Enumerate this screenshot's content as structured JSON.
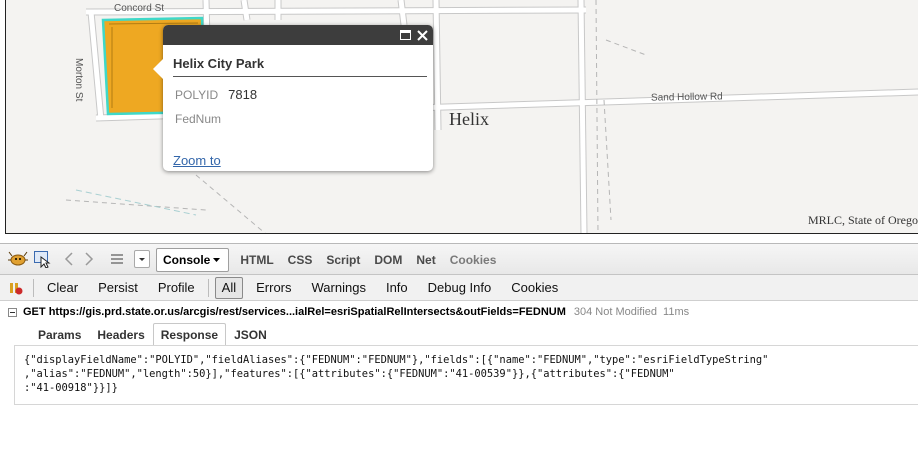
{
  "map": {
    "streets": {
      "concord": "Concord St",
      "morton": "Morton St",
      "sand_hollow": "Sand Hollow Rd"
    },
    "place_label": "Helix",
    "attribution": "MRLC, State of Orego",
    "parcel_color": "#eea822",
    "highlight_color": "#3fd8c8"
  },
  "popup": {
    "title": "Helix City Park",
    "fields": [
      {
        "label": "POLYID",
        "value": "7818"
      },
      {
        "label": "FedNum",
        "value": ""
      }
    ],
    "zoom_link": "Zoom to",
    "icons": [
      "maximize-icon",
      "close-icon"
    ]
  },
  "firebug": {
    "panel_tabs": [
      "Console",
      "HTML",
      "CSS",
      "Script",
      "DOM",
      "Net",
      "Cookies"
    ],
    "sub_buttons": [
      "Clear",
      "Persist",
      "Profile"
    ],
    "filters": [
      "All",
      "Errors",
      "Warnings",
      "Info",
      "Debug Info",
      "Cookies"
    ],
    "active_filter": "All",
    "request": {
      "method": "GET",
      "url": "https://gis.prd.state.or.us/arcgis/rest/services...ialRel=esriSpatialRelIntersects&outFields=FEDNUM",
      "status": "304 Not Modified",
      "time": "11ms"
    },
    "response_tabs": [
      "Params",
      "Headers",
      "Response",
      "JSON"
    ],
    "active_response_tab": "Response",
    "response_body": "{\"displayFieldName\":\"POLYID\",\"fieldAliases\":{\"FEDNUM\":\"FEDNUM\"},\"fields\":[{\"name\":\"FEDNUM\",\"type\":\"esriFieldTypeString\"\n,\"alias\":\"FEDNUM\",\"length\":50}],\"features\":[{\"attributes\":{\"FEDNUM\":\"41-00539\"}},{\"attributes\":{\"FEDNUM\"\n:\"41-00918\"}}]}"
  }
}
